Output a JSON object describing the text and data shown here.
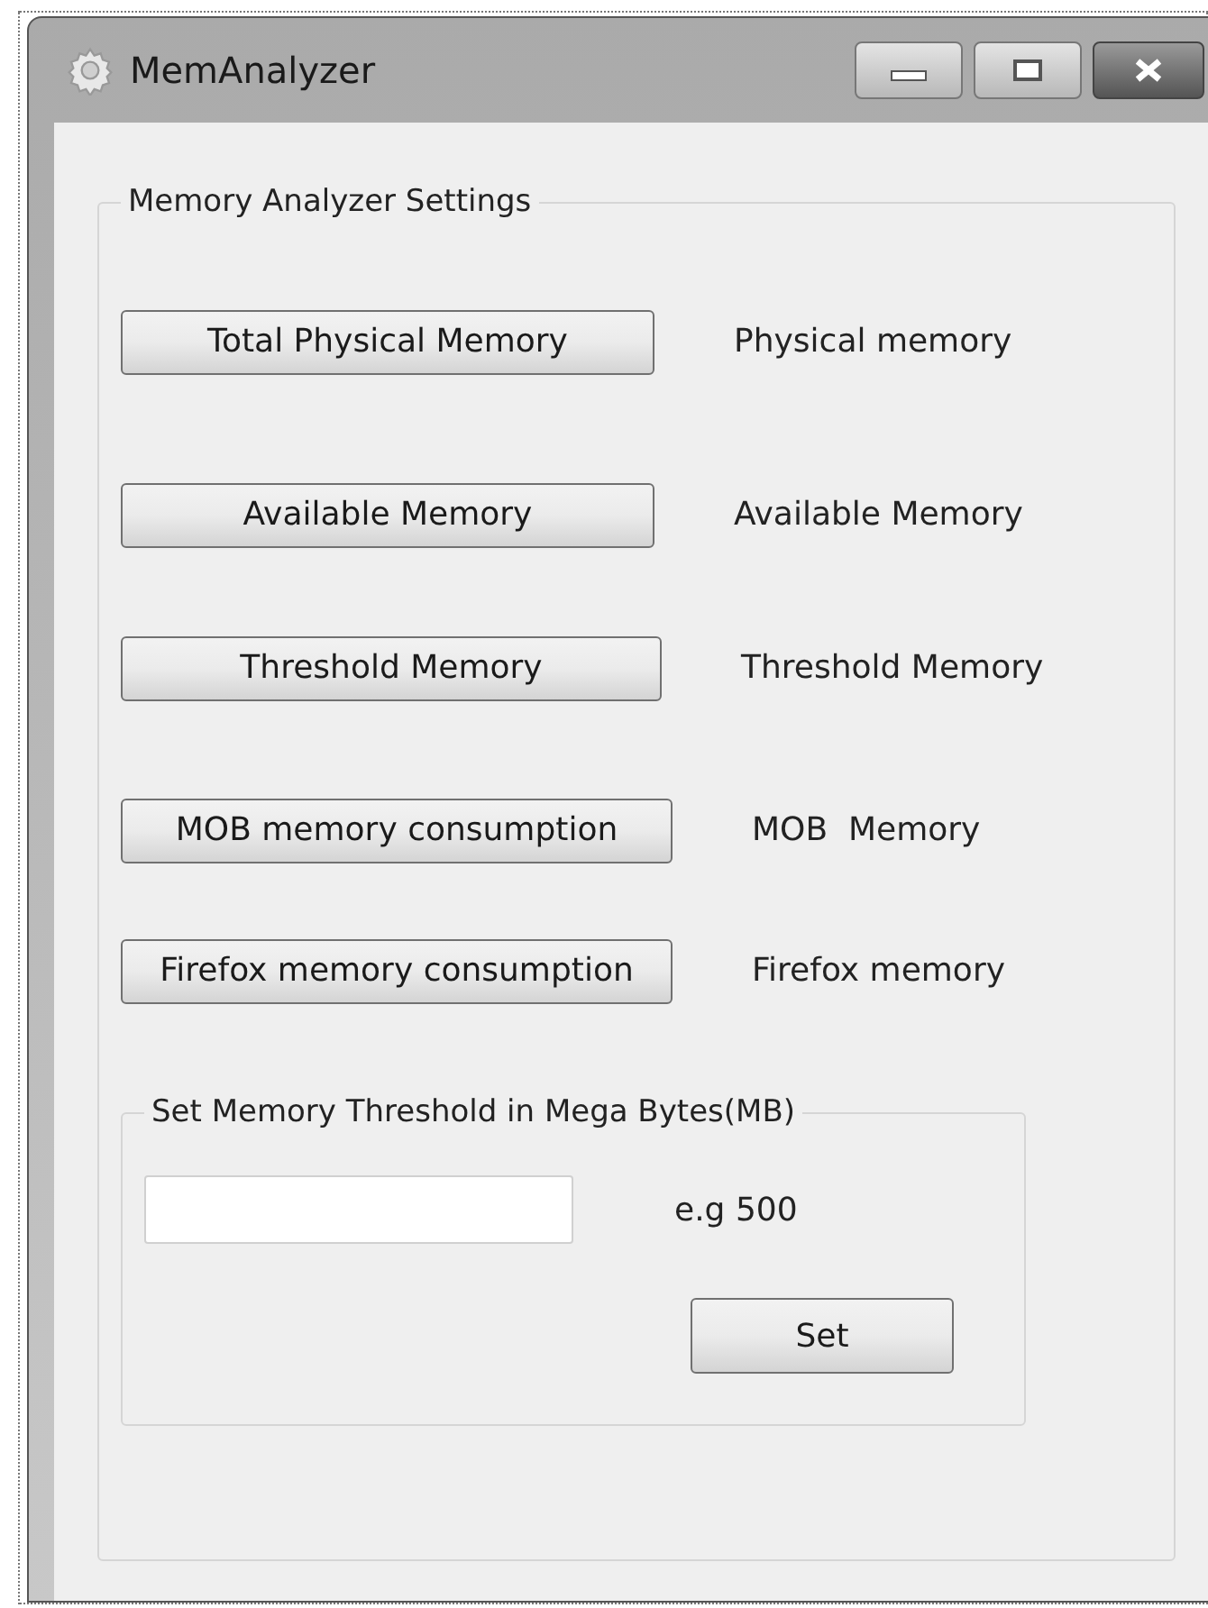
{
  "window": {
    "title": "MemAnalyzer"
  },
  "settings": {
    "title": "Memory Analyzer Settings",
    "rows": [
      {
        "button": "Total Physical Memory",
        "label": "Physical memory"
      },
      {
        "button": "Available Memory",
        "label": "Available Memory"
      },
      {
        "button": "Threshold Memory",
        "label": "Threshold Memory"
      },
      {
        "button": "MOB memory consumption",
        "label": "MOB  Memory"
      },
      {
        "button": "Firefox memory consumption",
        "label": "Firefox memory"
      }
    ]
  },
  "threshold": {
    "title": "Set Memory Threshold in Mega Bytes(MB)",
    "hint": "e.g 500",
    "button": "Set"
  }
}
